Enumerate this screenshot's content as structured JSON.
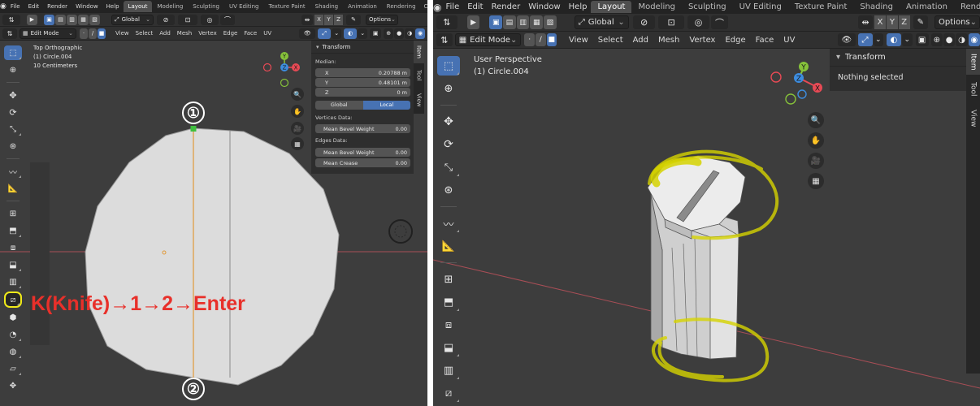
{
  "menu": [
    "File",
    "Edit",
    "Render",
    "Window",
    "Help"
  ],
  "workspaces_left": [
    "Layout",
    "Modeling",
    "Sculpting",
    "UV Editing",
    "Texture Paint",
    "Shading",
    "Animation",
    "Rendering",
    "C"
  ],
  "workspaces_right": [
    "Layout",
    "Modeling",
    "Sculpting",
    "UV Editing",
    "Texture Paint",
    "Shading",
    "Animation",
    "Rendering"
  ],
  "active_workspace": "Layout",
  "header": {
    "orientation": "Global",
    "options": "Options",
    "axes": [
      "X",
      "Y",
      "Z"
    ],
    "mode": "Edit Mode",
    "menus": [
      "View",
      "Select",
      "Add",
      "Mesh",
      "Vertex",
      "Edge",
      "Face",
      "UV"
    ]
  },
  "left_view": {
    "view_name": "Top Orthographic",
    "object": "(1) Circle.004",
    "scale": "10 Centimeters",
    "annotation": "K(Knife)→1→2→Enter",
    "point_labels": [
      "①",
      "②"
    ]
  },
  "right_view": {
    "view_name": "User Perspective",
    "object": "(1) Circle.004"
  },
  "transform_panel": {
    "title": "Transform",
    "median_label": "Median:",
    "x": {
      "label": "X",
      "value": "0.20788 m"
    },
    "y": {
      "label": "Y",
      "value": "0.48101 m"
    },
    "z": {
      "label": "Z",
      "value": "0 m"
    },
    "global": "Global",
    "local": "Local",
    "vertices_data": "Vertices Data:",
    "mean_bevel_weight": "Mean Bevel Weight",
    "vert_bevel_value": "0.00",
    "edges_data": "Edges Data:",
    "edge_bevel_value": "0.00",
    "mean_crease": "Mean Crease",
    "crease_value": "0.00"
  },
  "right_transform_panel": {
    "title": "Transform",
    "message": "Nothing selected"
  },
  "sidebar_tabs": [
    "Item",
    "Tool",
    "View"
  ],
  "colors": {
    "accent": "#4772b3",
    "annotation_red": "#e8302a",
    "highlight_yellow": "#e8e800",
    "axis_x": "#e84a55",
    "axis_y": "#86c23a",
    "axis_z": "#3d8de0",
    "mesh_fill": "#dcdcdc"
  },
  "icons": [
    "blender-logo",
    "select-box-icon",
    "cursor-icon",
    "move-icon",
    "rotate-icon",
    "scale-icon",
    "transform-icon",
    "annotate-icon",
    "measure-icon",
    "add-cube-icon",
    "extrude-icon",
    "inset-icon",
    "bevel-icon",
    "loop-cut-icon",
    "knife-icon",
    "poly-build-icon",
    "spin-icon",
    "smooth-icon",
    "shear-icon",
    "zoom-icon",
    "hand-icon",
    "camera-icon",
    "grid-icon"
  ]
}
